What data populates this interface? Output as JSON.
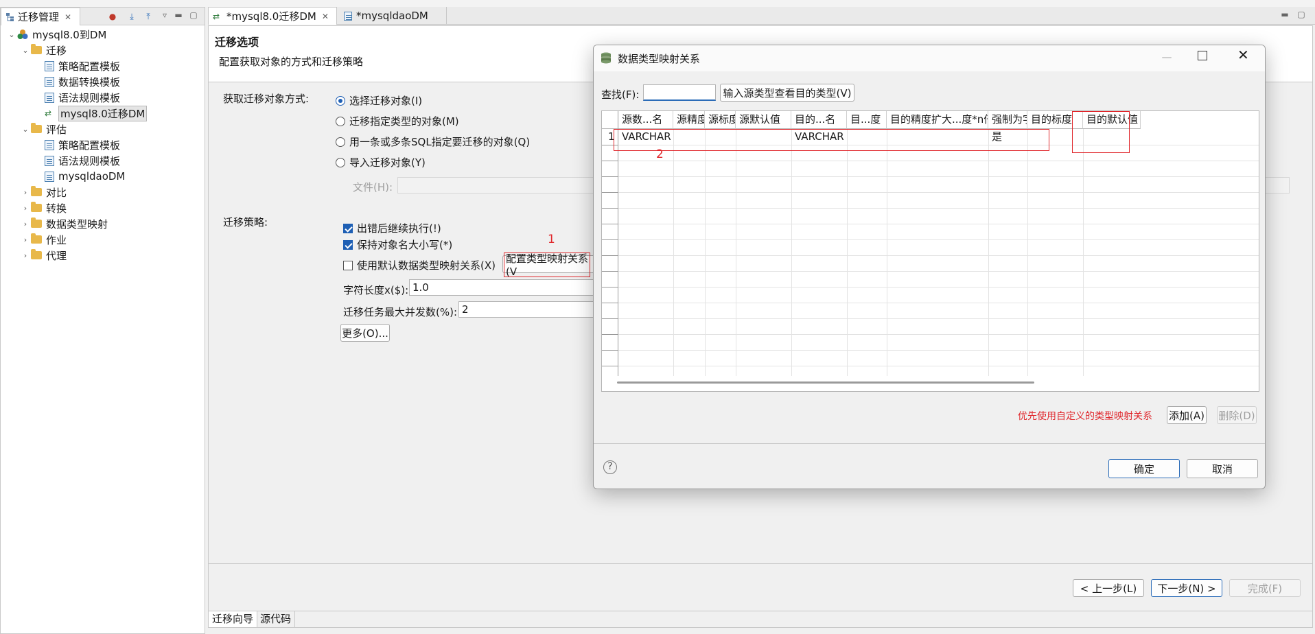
{
  "left_panel": {
    "tab_label": "迁移管理",
    "tree": [
      {
        "label": "mysql8.0到DM",
        "level": 0,
        "kind": "db",
        "expanded": true
      },
      {
        "label": "迁移",
        "level": 1,
        "kind": "folder-open",
        "expanded": true
      },
      {
        "label": "策略配置模板",
        "level": 2,
        "kind": "file"
      },
      {
        "label": "数据转换模板",
        "level": 2,
        "kind": "file"
      },
      {
        "label": "语法规则模板",
        "level": 2,
        "kind": "file"
      },
      {
        "label": "mysql8.0迁移DM",
        "level": 2,
        "kind": "migration",
        "selected": true
      },
      {
        "label": "评估",
        "level": 1,
        "kind": "folder-open",
        "expanded": true
      },
      {
        "label": "策略配置模板",
        "level": 2,
        "kind": "file"
      },
      {
        "label": "语法规则模板",
        "level": 2,
        "kind": "file"
      },
      {
        "label": "mysqldaoDM",
        "level": 2,
        "kind": "file"
      },
      {
        "label": "对比",
        "level": 1,
        "kind": "folder"
      },
      {
        "label": "转换",
        "level": 1,
        "kind": "folder"
      },
      {
        "label": "数据类型映射",
        "level": 1,
        "kind": "folder"
      },
      {
        "label": "作业",
        "level": 1,
        "kind": "folder"
      },
      {
        "label": "代理",
        "level": 1,
        "kind": "folder"
      }
    ]
  },
  "editor": {
    "tabs": [
      {
        "label": "*mysql8.0迁移DM",
        "active": true
      },
      {
        "label": "*mysqldaoDM",
        "active": false
      }
    ],
    "section_title": "迁移选项",
    "section_desc": "配置获取对象的方式和迁移策略",
    "fetch_label": "获取迁移对象方式:",
    "fetch_options": [
      {
        "label": "选择迁移对象(I)",
        "checked": true
      },
      {
        "label": "迁移指定类型的对象(M)",
        "checked": false
      },
      {
        "label": "用一条或多条SQL指定要迁移的对象(Q)",
        "checked": false
      },
      {
        "label": "导入迁移对象(Y)",
        "checked": false
      }
    ],
    "file_label": "文件(H):",
    "strategy_label": "迁移策略:",
    "strategy_checks": [
      {
        "label": "出错后继续执行(!)",
        "checked": true
      },
      {
        "label": "保持对象名大小写(*)",
        "checked": true
      },
      {
        "label": "使用默认数据类型映射关系(X)",
        "checked": false
      }
    ],
    "config_mapping_button": "配置类型映射关系(V",
    "char_len_label": "字符长度x($):",
    "char_len_value": "1.0",
    "max_concurrency_label": "迁移任务最大并发数(%):",
    "max_concurrency_value": "2",
    "more_button": "更多(O)...",
    "prev_button": "< 上一步(L)",
    "next_button": "下一步(N) >",
    "finish_button": "完成(F)",
    "bottom_tabs": [
      "迁移向导",
      "源代码"
    ],
    "annotation_1": "1"
  },
  "dialog": {
    "title": "数据类型映射关系",
    "search_label": "查找(F):",
    "search_value": "",
    "lookup_button": "输入源类型查看目的类型(V)",
    "columns": [
      "源数...名",
      "源精度",
      "源标度",
      "源默认值",
      "目的...名",
      "目...度",
      "目的精度扩大...度*n倍)",
      "强制为字",
      "目的标度",
      "目的默认值"
    ],
    "rows": [
      {
        "num": "1",
        "cells": [
          "VARCHAR",
          "",
          "",
          "",
          "VARCHAR",
          "",
          "",
          "是",
          "",
          ""
        ]
      }
    ],
    "annotation_2": "2",
    "hint": "优先使用自定义的类型映射关系",
    "add_button": "添加(A)",
    "delete_button": "删除(D)",
    "ok_button": "确定",
    "cancel_button": "取消",
    "help_icon": "?",
    "hint_color": "#e0262b"
  }
}
